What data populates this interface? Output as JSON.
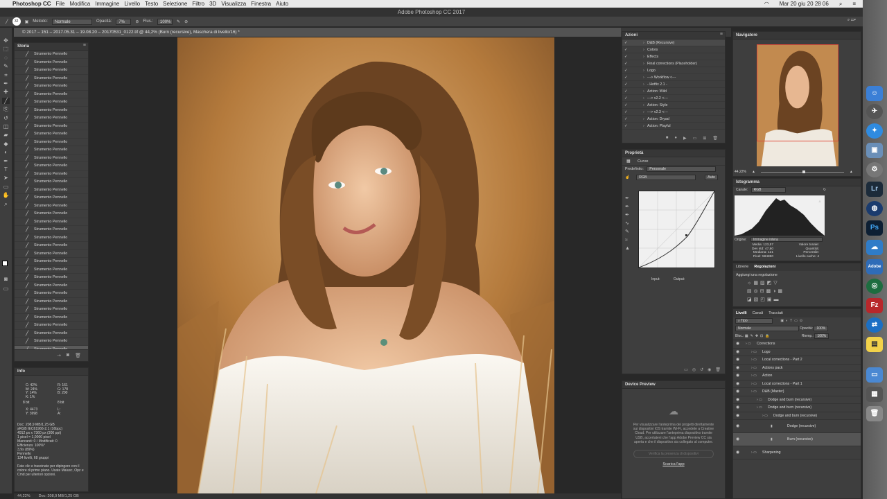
{
  "menubar": {
    "app_name": "Photoshop CC",
    "items": [
      "File",
      "Modifica",
      "Immagine",
      "Livello",
      "Testo",
      "Selezione",
      "Filtro",
      "3D",
      "Visualizza",
      "Finestra",
      "Aiuto"
    ],
    "clock": "Mar 20 giu  20 28 06"
  },
  "window_title": "Adobe Photoshop CC 2017",
  "options_bar": {
    "brush_size": "32",
    "mode_label": "Metodo:",
    "mode_value": "Normale",
    "opacity_label": "Opacità:",
    "opacity_value": "7%",
    "flow_label": "Flus.:",
    "flow_value": "100%"
  },
  "document_tab": "© 2017 – 151 – 2017.05.31 – 19.08.20 – 20170531_0122.tif @ 44,2% (Burn (recursive), Maschera di livello/16) *",
  "history": {
    "title": "Storia",
    "item_label": "Strumento Pennello",
    "count": 38
  },
  "info": {
    "title": "Info",
    "c": "42%",
    "m": "24%",
    "y": "14%",
    "k": "1%",
    "r": "161",
    "g": "178",
    "b": "200",
    "bit_left": "8 bit",
    "bit_right": "8 bit",
    "x": "4473",
    "yv": "3998",
    "doc_lines": [
      "Doc: 208,9 MB/1,25 GB",
      "sRGB IEC61966-2.1 (16bpc)",
      "4912 px x 7360 px (300 ppi)",
      "1 pixel = 1,0000 pixel",
      "Mancanti: 0 / Modificati: 0",
      "Efficienza: 100%*",
      "3,9s (89%)",
      "Pennello",
      "134 livelli, 68 gruppi"
    ],
    "hint": "Fate clic e trascinate per dipingere con il colore di primo piano. Usate Maiusc, Opz e Cmd per ulteriori opzioni."
  },
  "status": {
    "zoom": "44,22%",
    "doc": "Doc: 208,9 MB/1,25 GB"
  },
  "actions": {
    "title": "Azioni",
    "items": [
      "D&B (Recursive)",
      "Colors",
      "Effects",
      "Final corrections (Placeholder)",
      "Logo",
      "---> Workflow <---",
      "- Hotfix 2.1 -",
      "Action: Wild",
      "---> v2.2 <---",
      "Action: Style",
      "---> v2.3 <---",
      "Action: Dryad",
      "Action: Playful"
    ]
  },
  "properties": {
    "title": "Proprietà",
    "type": "Curve",
    "preset_label": "Predefinito:",
    "preset_value": "Personale",
    "channel": "RGB",
    "auto": "Auto",
    "input_label": "Input:",
    "output_label": "Output:"
  },
  "device_preview": {
    "title": "Device Preview",
    "text": "Per visualizzare l'anteprima dei progetti direttamente sui dispositivi iOS tramite Wi-Fi, accedete a Creative Cloud. Per utilizzare l'anteprima dispositivo tramite USB, accertatevi che l'app Adobe Preview CC sia aperta e che il dispositivo sia collegato al computer.",
    "button": "Verifica la presenza di dispositivi",
    "link": "Scarica l'app"
  },
  "navigator": {
    "title": "Navigatore",
    "zoom": "44,22%"
  },
  "histogram": {
    "title": "Istogramma",
    "channel_label": "Canale:",
    "channel": "RGB",
    "source_label": "Origine:",
    "source": "Immagine intera",
    "media_label": "Media:",
    "media": "123,57",
    "devstd_label": "Dev std:",
    "devstd": "47,80",
    "mediana_label": "Mediana:",
    "mediana": "121",
    "pixel_label": "Pixel:",
    "pixel": "584880",
    "valore_label": "Valore tonale:",
    "quantita_label": "Quantità:",
    "percentile_label": "Percentile:",
    "cache_label": "Livello cache:",
    "cache": "4"
  },
  "adjustments": {
    "tab1": "Librerie",
    "tab2": "Regolazioni",
    "subtitle": "Aggiungi una regolazione"
  },
  "layers": {
    "tabs": [
      "Livelli",
      "Canali",
      "Tracciati"
    ],
    "filter": "Tipo",
    "blend": "Normale",
    "opacity_label": "Opacità:",
    "opacity": "100%",
    "lock_label": "Bloc.:",
    "fill_label": "Riemp.:",
    "fill": "100%",
    "items": [
      "Corrections",
      "Logo",
      "Local corrections - Part 2",
      "Actions pack",
      "Action",
      "Local corrections - Part 1",
      "D&B (Master)",
      "Dodge and burn (recursive)",
      "Dodge and burn (recursive)",
      "Dodge and burn (recursive)",
      "Dodge (recursive)",
      "Burn (recursive)",
      "Sharpening"
    ]
  },
  "dock": {
    "lr": "Lr",
    "ps": "Ps",
    "adobe": "Adobe",
    "fz": "Fz"
  }
}
